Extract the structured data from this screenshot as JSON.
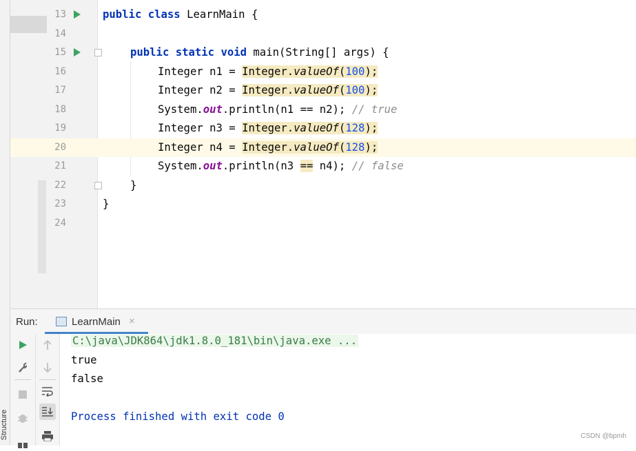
{
  "sidebar": {
    "structure_label": "Structure"
  },
  "editor": {
    "lines": [
      {
        "number": "13"
      },
      {
        "number": "14"
      },
      {
        "number": "15"
      },
      {
        "number": "16"
      },
      {
        "number": "17"
      },
      {
        "number": "18"
      },
      {
        "number": "19"
      },
      {
        "number": "20"
      },
      {
        "number": "21"
      },
      {
        "number": "22"
      },
      {
        "number": "23"
      },
      {
        "number": "24"
      }
    ],
    "code": {
      "l13": {
        "kw1": "public",
        "kw2": "class",
        "name": "LearnMain {"
      },
      "l15": {
        "kw1": "public",
        "kw2": "static",
        "kw3": "void",
        "rest": "main(String[] args) {"
      },
      "l16": {
        "decl": "Integer n1 = ",
        "cls": "Integer.",
        "method": "valueOf",
        "open": "(",
        "num": "100",
        "close": ");"
      },
      "l17": {
        "decl": "Integer n2 = ",
        "cls": "Integer.",
        "method": "valueOf",
        "open": "(",
        "num": "100",
        "close": ");"
      },
      "l18": {
        "sys": "System.",
        "out": "out",
        "print": ".println(n1 ",
        "eq": "==",
        "rest": " n2); ",
        "comment": "// true"
      },
      "l19": {
        "decl": "Integer n3 = ",
        "cls": "Integer.",
        "method": "valueOf",
        "open": "(",
        "num": "128",
        "close": ");"
      },
      "l20": {
        "decl": "Integer n4 = ",
        "cls": "Integer.",
        "method": "valueOf",
        "open": "(",
        "num": "128",
        "close": ");"
      },
      "l21": {
        "sys": "System.",
        "out": "out",
        "print": ".println(n3 ",
        "eq": "==",
        "rest": " n4); ",
        "comment": "// false"
      },
      "l22": {
        "text": "}"
      },
      "l23": {
        "text": "}"
      }
    }
  },
  "run_panel": {
    "label": "Run:",
    "tab_label": "LearnMain",
    "tab_close": "×",
    "console": {
      "command": "C:\\java\\JDK864\\jdk1.8.0_181\\bin\\java.exe ...",
      "output": [
        "true",
        "false"
      ],
      "exit_message": "Process finished with exit code 0"
    }
  },
  "watermark": "CSDN @bpmh",
  "colors": {
    "keyword": "#0033b3",
    "number": "#1750eb",
    "static_field": "#871094",
    "comment": "#8c8c8c",
    "run_green": "#3da361",
    "exit_text": "#0033b3"
  }
}
